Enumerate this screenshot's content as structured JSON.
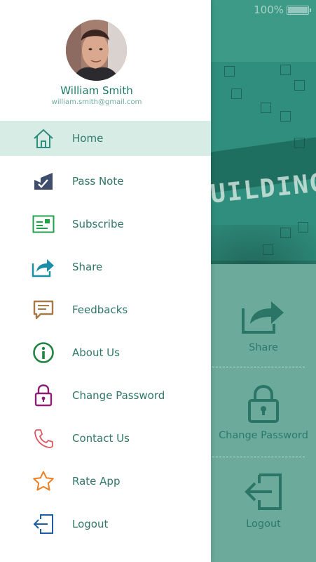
{
  "status_bar": {
    "battery_text": "100%"
  },
  "banner": {
    "word": "UILDING"
  },
  "profile": {
    "name": "William Smith",
    "email": "william.smith@gmail.com"
  },
  "menu": [
    {
      "label": "Home",
      "icon": "home-icon",
      "color": "#2f8e7d",
      "active": true
    },
    {
      "label": "Pass Note",
      "icon": "pass-note-icon",
      "color": "#3d4d6b",
      "active": false
    },
    {
      "label": "Subscribe",
      "icon": "subscribe-icon",
      "color": "#22a04a",
      "active": false
    },
    {
      "label": "Share",
      "icon": "share-icon",
      "color": "#1b8fa8",
      "active": false
    },
    {
      "label": "Feedbacks",
      "icon": "feedback-icon",
      "color": "#a57a48",
      "active": false
    },
    {
      "label": "About Us",
      "icon": "info-icon",
      "color": "#1f8540",
      "active": false
    },
    {
      "label": "Change Password",
      "icon": "lock-icon",
      "color": "#8a1f73",
      "active": false
    },
    {
      "label": "Contact Us",
      "icon": "phone-icon",
      "color": "#e05561",
      "active": false
    },
    {
      "label": "Rate App",
      "icon": "star-icon",
      "color": "#ee7d21",
      "active": false
    },
    {
      "label": "Logout",
      "icon": "logout-icon",
      "color": "#1d5fa5",
      "active": false
    }
  ],
  "background_menu": [
    {
      "label": "Share",
      "icon": "share-icon"
    },
    {
      "label": "Change Password",
      "icon": "lock-icon"
    },
    {
      "label": "Logout",
      "icon": "logout-icon"
    }
  ],
  "colors": {
    "accent": "#2f8e7d",
    "active_bg": "#d7ece5",
    "background_panel": "#6cab9c"
  }
}
